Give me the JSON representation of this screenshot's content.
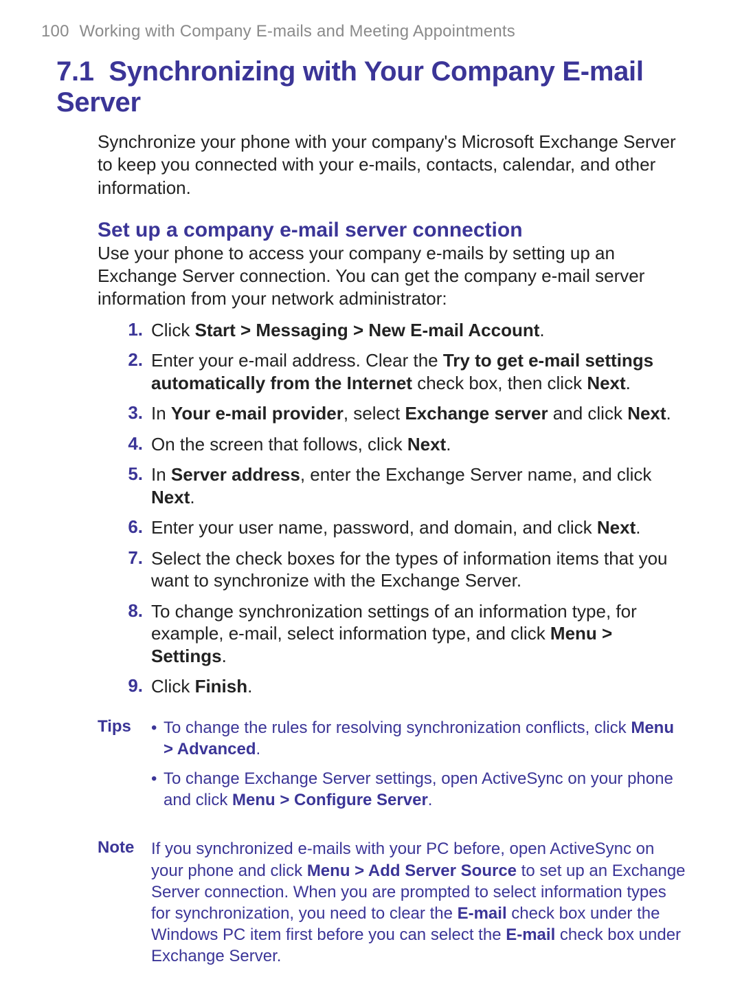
{
  "header": {
    "page_number": "100",
    "chapter_title": "Working with Company E-mails and Meeting Appointments"
  },
  "section": {
    "number": "7.1",
    "title": "Synchronizing with Your Company E-mail Server",
    "intro": "Synchronize your phone with your company's Microsoft Exchange Server to keep you connected with your e-mails, contacts, calendar, and other information.",
    "setup": {
      "heading": "Set up a company e-mail server connection",
      "lead": "Use your phone to access your company e-mails by setting up an Exchange Server connection. You can get the company e-mail server information from your network administrator:",
      "steps": [
        {
          "num": "1.",
          "pre": "Click ",
          "bold": "Start > Messaging > New E-mail Account",
          "post": "."
        },
        {
          "num": "2.",
          "pre": "Enter your e-mail address. Clear the ",
          "bold": "Try to get e-mail settings automatically from the Internet",
          "mid": " check box, then click ",
          "bold2": "Next",
          "post": "."
        },
        {
          "num": "3.",
          "pre": "In ",
          "bold": "Your e-mail provider",
          "mid": ", select ",
          "bold2": "Exchange server",
          "mid2": " and click ",
          "bold3": "Next",
          "post": "."
        },
        {
          "num": "4.",
          "pre": "On the screen that follows, click ",
          "bold": "Next",
          "post": "."
        },
        {
          "num": "5.",
          "pre": "In ",
          "bold": "Server address",
          "mid": ", enter the Exchange Server name, and click ",
          "bold2": "Next",
          "post": "."
        },
        {
          "num": "6.",
          "pre": "Enter your user name, password, and domain, and click ",
          "bold": "Next",
          "post": "."
        },
        {
          "num": "7.",
          "full": "Select the check boxes for the types of information items that you want to synchronize with the Exchange Server."
        },
        {
          "num": "8.",
          "pre": "To change synchronization settings of an information type, for example, e-mail, select information type, and click ",
          "bold": "Menu > Settings",
          "post": "."
        },
        {
          "num": "9.",
          "pre": "Click ",
          "bold": "Finish",
          "post": "."
        }
      ]
    },
    "tips": {
      "label": "Tips",
      "items": [
        {
          "pre": "To change the rules for resolving synchronization conflicts, click ",
          "bold": "Menu > Advanced",
          "post": "."
        },
        {
          "pre": "To change Exchange Server settings, open ActiveSync on your phone and click ",
          "bold": "Menu > Configure Server",
          "post": "."
        }
      ]
    },
    "note": {
      "label": "Note",
      "pre": "If you synchronized e-mails with your PC before, open ActiveSync on your phone and click ",
      "bold": "Menu > Add Server Source",
      "mid": " to set up an Exchange Server connection. When you are prompted to select information types for synchronization, you need to clear the ",
      "bold2": "E-mail",
      "mid2": " check box under the Windows PC item first before you can select the ",
      "bold3": "E-mail",
      "post": " check box under Exchange Server."
    }
  }
}
